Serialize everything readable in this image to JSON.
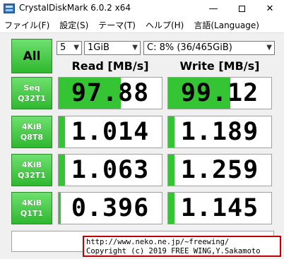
{
  "window": {
    "title": "CrystalDiskMark 6.0.2 x64",
    "minimize_glyph": "—",
    "close_glyph": "✕"
  },
  "menu": [
    {
      "label": "ファイル(F)"
    },
    {
      "label": "設定(S)"
    },
    {
      "label": "テーマ(T)"
    },
    {
      "label": "ヘルプ(H)"
    },
    {
      "label": "言語(Language)"
    }
  ],
  "controls": {
    "all_label": "All",
    "test_count": "5",
    "test_size": "1GiB",
    "drive": "C: 8% (36/465GiB)",
    "dropdown_glyph": "▼"
  },
  "headers": {
    "read": "Read [MB/s]",
    "write": "Write [MB/s]"
  },
  "rows": [
    {
      "label1": "Seq",
      "label2": "Q32T1",
      "read": "97.88",
      "write": "99.12",
      "read_fraction": 0.6,
      "write_fraction": 0.6
    },
    {
      "label1": "4KiB",
      "label2": "Q8T8",
      "read": "1.014",
      "write": "1.189",
      "read_fraction": 0.06,
      "write_fraction": 0.06
    },
    {
      "label1": "4KiB",
      "label2": "Q32T1",
      "read": "1.063",
      "write": "1.259",
      "read_fraction": 0.06,
      "write_fraction": 0.06
    },
    {
      "label1": "4KiB",
      "label2": "Q1T1",
      "read": "0.396",
      "write": "1.145",
      "read_fraction": 0.02,
      "write_fraction": 0.06
    }
  ],
  "footer": {
    "comment": "",
    "copyright_line1": "http://www.neko.ne.jp/~freewing/",
    "copyright_line2": "Copyright (c) 2019 FREE WING,Y.Sakamoto"
  },
  "colors": {
    "bar": "#34c434",
    "button": "#3cc43c",
    "copyright_border": "#c00000"
  }
}
